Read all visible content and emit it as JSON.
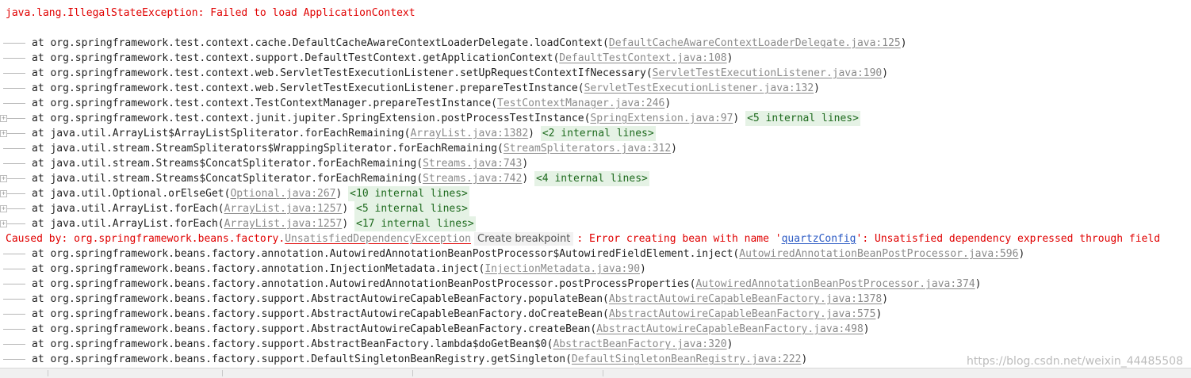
{
  "exception_header": "java.lang.IllegalStateException: Failed to load ApplicationContext",
  "frames_a": [
    {
      "text": "at org.springframework.test.context.cache.DefaultCacheAwareContextLoaderDelegate.loadContext(",
      "link": "DefaultCacheAwareContextLoaderDelegate.java:125",
      "after": ")",
      "internal": "",
      "expander": false
    },
    {
      "text": "at org.springframework.test.context.support.DefaultTestContext.getApplicationContext(",
      "link": "DefaultTestContext.java:108",
      "after": ")",
      "internal": "",
      "expander": false
    },
    {
      "text": "at org.springframework.test.context.web.ServletTestExecutionListener.setUpRequestContextIfNecessary(",
      "link": "ServletTestExecutionListener.java:190",
      "after": ")",
      "internal": "",
      "expander": false
    },
    {
      "text": "at org.springframework.test.context.web.ServletTestExecutionListener.prepareTestInstance(",
      "link": "ServletTestExecutionListener.java:132",
      "after": ")",
      "internal": "",
      "expander": false
    },
    {
      "text": "at org.springframework.test.context.TestContextManager.prepareTestInstance(",
      "link": "TestContextManager.java:246",
      "after": ")",
      "internal": "",
      "expander": false
    },
    {
      "text": "at org.springframework.test.context.junit.jupiter.SpringExtension.postProcessTestInstance(",
      "link": "SpringExtension.java:97",
      "after": ") ",
      "internal": "<5 internal lines>",
      "expander": true
    },
    {
      "text": "at java.util.ArrayList$ArrayListSpliterator.forEachRemaining(",
      "link": "ArrayList.java:1382",
      "after": ") ",
      "internal": "<2 internal lines>",
      "expander": true
    },
    {
      "text": "at java.util.stream.StreamSpliterators$WrappingSpliterator.forEachRemaining(",
      "link": "StreamSpliterators.java:312",
      "after": ")",
      "internal": "",
      "expander": false
    },
    {
      "text": "at java.util.stream.Streams$ConcatSpliterator.forEachRemaining(",
      "link": "Streams.java:743",
      "after": ")",
      "internal": "",
      "expander": false
    },
    {
      "text": "at java.util.stream.Streams$ConcatSpliterator.forEachRemaining(",
      "link": "Streams.java:742",
      "after": ") ",
      "internal": "<4 internal lines>",
      "expander": true
    },
    {
      "text": "at java.util.Optional.orElseGet(",
      "link": "Optional.java:267",
      "after": ") ",
      "internal": "<10 internal lines>",
      "expander": true
    },
    {
      "text": "at java.util.ArrayList.forEach(",
      "link": "ArrayList.java:1257",
      "after": ") ",
      "internal": "<5 internal lines>",
      "expander": true
    },
    {
      "text": "at java.util.ArrayList.forEach(",
      "link": "ArrayList.java:1257",
      "after": ") ",
      "internal": "<17 internal lines>",
      "expander": true
    }
  ],
  "caused_by": {
    "prefix": "Caused by: org.springframework.beans.factory.",
    "exception_link": "UnsatisfiedDependencyException",
    "tooltip": "Create breakpoint",
    "middle": ": Error creating bean with name '",
    "bean_link": "quartzConfig",
    "suffix": "': Unsatisfied dependency expressed through field"
  },
  "frames_b": [
    {
      "text": "at org.springframework.beans.factory.annotation.AutowiredAnnotationBeanPostProcessor$AutowiredFieldElement.inject(",
      "link": "AutowiredAnnotationBeanPostProcessor.java:596",
      "after": ")",
      "internal": "",
      "expander": false
    },
    {
      "text": "at org.springframework.beans.factory.annotation.InjectionMetadata.inject(",
      "link": "InjectionMetadata.java:90",
      "after": ")",
      "internal": "",
      "expander": false
    },
    {
      "text": "at org.springframework.beans.factory.annotation.AutowiredAnnotationBeanPostProcessor.postProcessProperties(",
      "link": "AutowiredAnnotationBeanPostProcessor.java:374",
      "after": ")",
      "internal": "",
      "expander": false
    },
    {
      "text": "at org.springframework.beans.factory.support.AbstractAutowireCapableBeanFactory.populateBean(",
      "link": "AbstractAutowireCapableBeanFactory.java:1378",
      "after": ")",
      "internal": "",
      "expander": false
    },
    {
      "text": "at org.springframework.beans.factory.support.AbstractAutowireCapableBeanFactory.doCreateBean(",
      "link": "AbstractAutowireCapableBeanFactory.java:575",
      "after": ")",
      "internal": "",
      "expander": false
    },
    {
      "text": "at org.springframework.beans.factory.support.AbstractAutowireCapableBeanFactory.createBean(",
      "link": "AbstractAutowireCapableBeanFactory.java:498",
      "after": ")",
      "internal": "",
      "expander": false
    },
    {
      "text": "at org.springframework.beans.factory.support.AbstractBeanFactory.lambda$doGetBean$0(",
      "link": "AbstractBeanFactory.java:320",
      "after": ")",
      "internal": "",
      "expander": false
    },
    {
      "text": "at org.springframework.beans.factory.support.DefaultSingletonBeanRegistry.getSingleton(",
      "link": "DefaultSingletonBeanRegistry.java:222",
      "after": ")",
      "internal": "",
      "expander": false
    }
  ],
  "watermark": "https://blog.csdn.net/weixin_44485508",
  "colors": {
    "error": "#e00000",
    "link": "#8a8a8a",
    "internal_bg": "#e5f2e5",
    "internal_fg": "#1e6a1e"
  }
}
